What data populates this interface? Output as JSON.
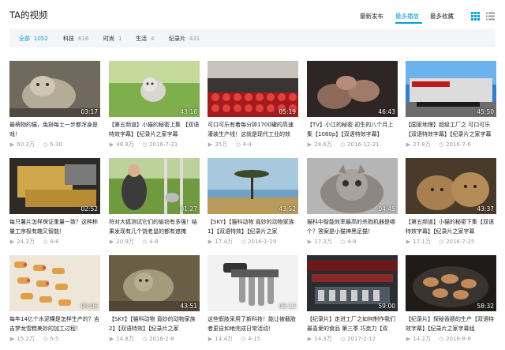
{
  "header": {
    "title": "TA的视频",
    "sort_options": [
      "最新发布",
      "最多播放",
      "最多收藏"
    ],
    "active_sort": 1,
    "accent_color": "#00a1d6"
  },
  "filters": [
    {
      "name": "全部",
      "count": "1052"
    },
    {
      "name": "科技",
      "count": "616"
    },
    {
      "name": "时尚",
      "count": "1"
    },
    {
      "name": "生活",
      "count": "4"
    },
    {
      "name": "纪录片",
      "count": "431"
    }
  ],
  "videos": [
    {
      "duration": "03:17",
      "title": "最萌物的猫，兔狲每土一步都浑身是戏！",
      "views": "60.3万",
      "date": "5-30"
    },
    {
      "duration": "43:16",
      "title": "【第五频道】小猫的秘密上集 【双语特效字幕】【纪录片之家字幕",
      "views": "48.8万",
      "date": "2016-7-21"
    },
    {
      "duration": "05:19",
      "title": "可口可乐有着每分钟1700罐的高速灌装生产线！这就是现代工业的效",
      "views": "35万",
      "date": "4-4"
    },
    {
      "duration": "46:43",
      "title": "【TV】小江的秘密 初生的八个月上集【1080p】【双语特效字幕】",
      "views": "28.6万",
      "date": "2016-12-21"
    },
    {
      "duration": "45:50",
      "title": "【国家地理】超级工厂之 可口可乐【双语特效字幕】【纪录片之家字幕",
      "views": "27.8万",
      "date": "2016-7-6"
    },
    {
      "duration": "02:52",
      "title": "每只薯片怎样保证重量一致？这种称量工序极有趣又智能！",
      "views": "24.3万",
      "date": "4-8"
    },
    {
      "duration": "01:27",
      "title": "符对大狐测试它们的偷窃有多强！结果发现有几个饶老鼠的都有遮掩",
      "views": "20.9万",
      "date": "4-8"
    },
    {
      "duration": "43:52",
      "title": "【SKY】【猫科动物 竟妙的动物家族 1】【双语特效】【纪录片之家",
      "views": "17.4万",
      "date": "2016-1-29"
    },
    {
      "duration": "04:45",
      "title": "猫科中智能效率最高的杀戮机器是哪个？答案是小猫神黑足猫！",
      "views": "17.3万",
      "date": "4-8"
    },
    {
      "duration": "43:37",
      "title": "【第五频道】小猫的秘密下集【双语特效字幕】【纪录片之家字幕",
      "views": "17.1万",
      "date": "2016-7-25"
    },
    {
      "duration": "04:06",
      "title": "每年14亿个水泥粿是怎样生产的？吉吉梦龙雪糕美妙的加工过程！",
      "views": "15.2万",
      "date": "5-5"
    },
    {
      "duration": "43:51",
      "title": "【SKY】【猫科动物 竟妙的动物家族 2】【双语特效】【纪录片之家",
      "views": "14.8万",
      "date": "2016-2-8"
    },
    {
      "duration": "03:13",
      "title": "这些假肢采用了新科技！能让被截肢者更自如地完成日常活动！",
      "views": "14.4万",
      "date": "4-15"
    },
    {
      "duration": "59:00",
      "title": "【纪录片】走进工厂之如何制作我们最喜爱的食品 第三季 巧克力【双",
      "views": "14.3万",
      "date": "2017-2-12"
    },
    {
      "duration": "58:32",
      "title": "【纪录片】探秘香肠的生产【双语特效字幕】【纪录片之家字幕组",
      "views": "14.2万",
      "date": "2016-8-8"
    }
  ]
}
